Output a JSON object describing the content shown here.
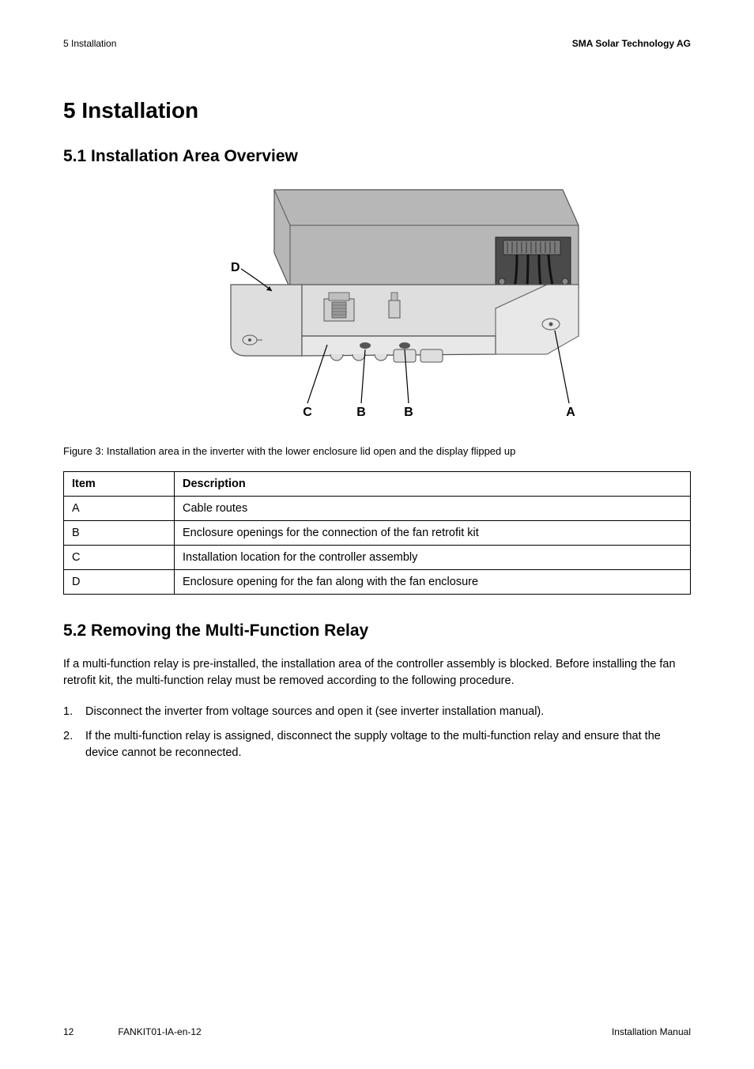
{
  "header": {
    "section_ref": "5  Installation",
    "company": "SMA Solar Technology AG"
  },
  "h1": "5   Installation",
  "section_5_1": {
    "title": "5.1   Installation Area Overview",
    "figure_labels": {
      "A": "A",
      "B": "B",
      "C": "C",
      "D": "D"
    },
    "figure_caption": "Figure 3:    Installation area in the inverter with the lower enclosure lid open and the display flipped up",
    "table": {
      "headers": {
        "item": "Item",
        "description": "Description"
      },
      "rows": [
        {
          "item": "A",
          "description": "Cable routes"
        },
        {
          "item": "B",
          "description": "Enclosure openings for the connection of the fan retrofit kit"
        },
        {
          "item": "C",
          "description": "Installation location for the controller assembly"
        },
        {
          "item": "D",
          "description": "Enclosure opening for the fan along with the fan enclosure"
        }
      ]
    }
  },
  "section_5_2": {
    "title": "5.2   Removing the Multi-Function Relay",
    "intro": "If a multi-function relay is pre-installed, the installation area of the controller assembly is blocked. Before installing the fan retrofit kit, the multi-function relay must be removed according to the following procedure.",
    "steps": [
      {
        "num": "1.",
        "text": "Disconnect the inverter from voltage sources and open it (see inverter installation manual)."
      },
      {
        "num": "2.",
        "text": "If the multi-function relay is assigned, disconnect the supply voltage to the multi-function relay and ensure that the device cannot be reconnected."
      }
    ]
  },
  "footer": {
    "page": "12",
    "doc_id": "FANKIT01-IA-en-12",
    "doc_type": "Installation Manual"
  }
}
